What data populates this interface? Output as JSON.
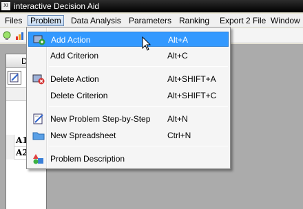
{
  "window": {
    "title": "interactive Decision Aid",
    "icon_text": "XI"
  },
  "menubar": {
    "items": [
      {
        "label": "Files"
      },
      {
        "label": "Problem"
      },
      {
        "label": "Data Analysis"
      },
      {
        "label": "Parameters"
      },
      {
        "label": "Ranking"
      },
      {
        "label": "Export 2 File"
      },
      {
        "label": "Window"
      }
    ],
    "active": "Problem"
  },
  "problem_menu": {
    "items": [
      {
        "label": "Add Action",
        "accel": "Alt+A",
        "icon": "add-action-icon",
        "highlighted": true
      },
      {
        "label": "Add Criterion",
        "accel": "Alt+C",
        "icon": ""
      },
      {
        "label": "Delete Action",
        "accel": "Alt+SHIFT+A",
        "icon": "delete-action-icon"
      },
      {
        "label": "Delete Criterion",
        "accel": "Alt+SHIFT+C",
        "icon": ""
      },
      {
        "label": "New Problem Step-by-Step",
        "accel": "Alt+N",
        "icon": "new-problem-icon"
      },
      {
        "label": "New Spreadsheet",
        "accel": "Ctrl+N",
        "icon": "folder-icon"
      },
      {
        "label": "Problem Description",
        "accel": "",
        "icon": "shapes-icon"
      }
    ]
  },
  "document": {
    "head_letter": "D",
    "rows": [
      "A1",
      "A2"
    ]
  },
  "colors": {
    "highlight": "#3399ff",
    "menu_bg": "#f5f5f5",
    "workspace": "#ababab"
  }
}
